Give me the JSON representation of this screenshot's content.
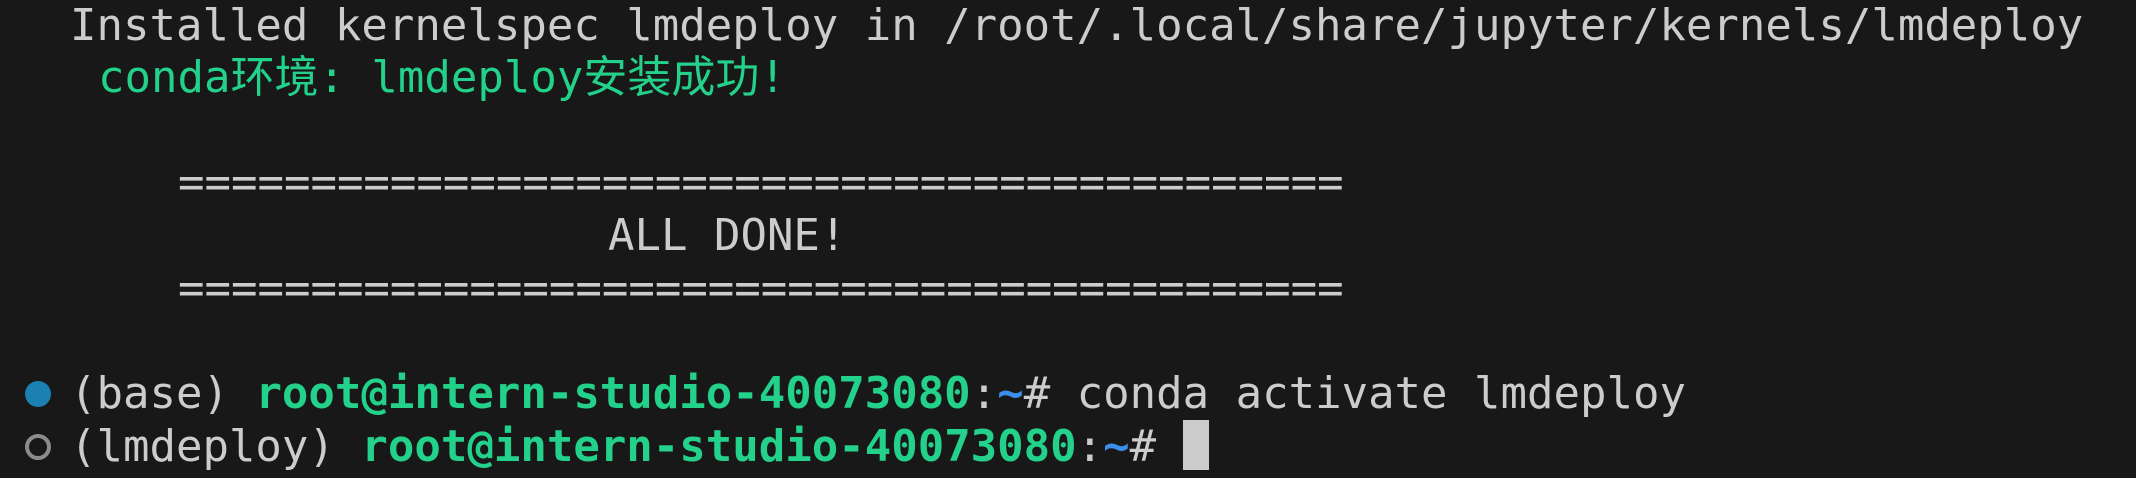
{
  "lines": {
    "installed": "Installed kernelspec lmdeploy in /root/.local/share/jupyter/kernels/lmdeploy",
    "conda_success": "conda环境: lmdeploy安装成功!",
    "separator_top": "============================================",
    "all_done": "ALL DONE!",
    "separator_bottom": "============================================"
  },
  "prompt1": {
    "env": "(base) ",
    "user_host": "root@intern-studio-40073080",
    "colon": ":",
    "path": "~",
    "symbol": "# ",
    "command": "conda activate lmdeploy"
  },
  "prompt2": {
    "env": "(lmdeploy) ",
    "user_host": "root@intern-studio-40073080",
    "colon": ":",
    "path": "~",
    "symbol": "# "
  },
  "colors": {
    "background": "#181818",
    "text": "#cccccc",
    "green": "#23d18b",
    "blue": "#3b8eea",
    "decoration_success": "#1b80b2",
    "decoration_idle": "#8b8b8b"
  },
  "icons": {
    "command_success": "filled-circle",
    "command_pending": "hollow-circle"
  }
}
